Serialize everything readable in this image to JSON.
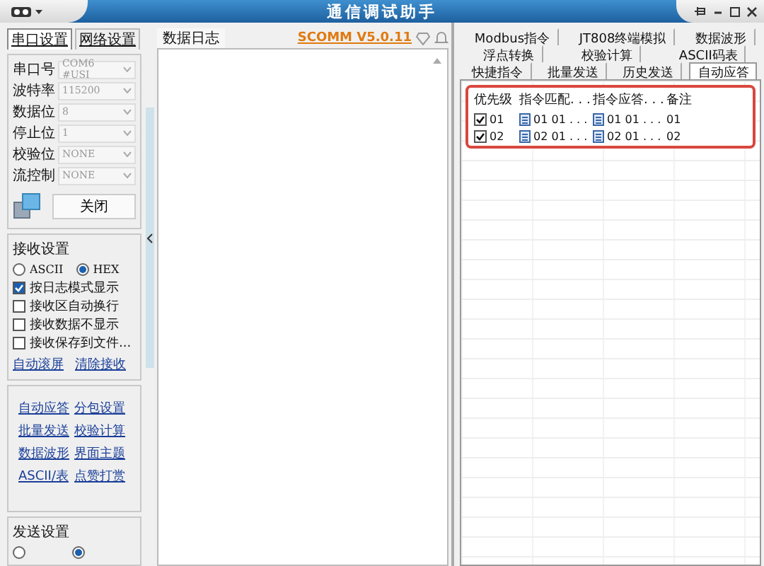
{
  "window": {
    "title": "通信调试助手"
  },
  "left_tabs": [
    {
      "label": "串口设置",
      "selected": true
    },
    {
      "label": "网络设置",
      "selected": false
    }
  ],
  "serial_fields": [
    {
      "label": "串口号",
      "value": "COM6 #USI"
    },
    {
      "label": "波特率",
      "value": "115200"
    },
    {
      "label": "数据位",
      "value": "8"
    },
    {
      "label": "停止位",
      "value": "1"
    },
    {
      "label": "校验位",
      "value": "NONE"
    },
    {
      "label": "流控制",
      "value": "NONE"
    }
  ],
  "port_button": "关闭",
  "receive_settings": {
    "title": "接收设置",
    "modes": [
      {
        "label": "ASCII",
        "selected": false
      },
      {
        "label": "HEX",
        "selected": true
      }
    ],
    "options": [
      {
        "label": "按日志模式显示",
        "checked": true
      },
      {
        "label": "接收区自动换行",
        "checked": false
      },
      {
        "label": "接收数据不显示",
        "checked": false
      },
      {
        "label": "接收保存到文件...",
        "checked": false
      }
    ],
    "links": [
      "自动滚屏",
      "清除接收"
    ]
  },
  "tool_links": [
    "自动应答",
    "分包设置",
    "批量发送",
    "校验计算",
    "数据波形",
    "界面主题",
    "ASCII/表",
    "点赞打赏"
  ],
  "send_settings": {
    "title": "发送设置",
    "modes": [
      {
        "selected": false
      },
      {
        "selected": true
      }
    ]
  },
  "log": {
    "title": "数据日志",
    "version": "SCOMM V5.0.11"
  },
  "tab_rows": [
    {
      "tabs": [
        {
          "label": "Modbus指令",
          "selected": false
        },
        {
          "label": "JT808终端模拟",
          "selected": false
        },
        {
          "label": "数据波形",
          "selected": false
        }
      ]
    },
    {
      "tabs": [
        {
          "label": "浮点转换",
          "selected": false
        },
        {
          "label": "校验计算",
          "selected": false
        },
        {
          "label": "ASCII码表",
          "selected": false
        }
      ]
    },
    {
      "tabs": [
        {
          "label": "快捷指令",
          "selected": false
        },
        {
          "label": "批量发送",
          "selected": false
        },
        {
          "label": "历史发送",
          "selected": false
        },
        {
          "label": "自动应答",
          "selected": true
        }
      ]
    }
  ],
  "table": {
    "columns": [
      "优先级",
      "指令匹配. . .",
      "指令应答. . .",
      "备注"
    ],
    "rows": [
      {
        "checked": true,
        "priority": "01",
        "match": "01 01 . . .",
        "reply": "01 01 . . .",
        "note": "01"
      },
      {
        "checked": true,
        "priority": "02",
        "match": "02 01 . . .",
        "reply": "02 01 . . .",
        "note": "02"
      }
    ]
  }
}
